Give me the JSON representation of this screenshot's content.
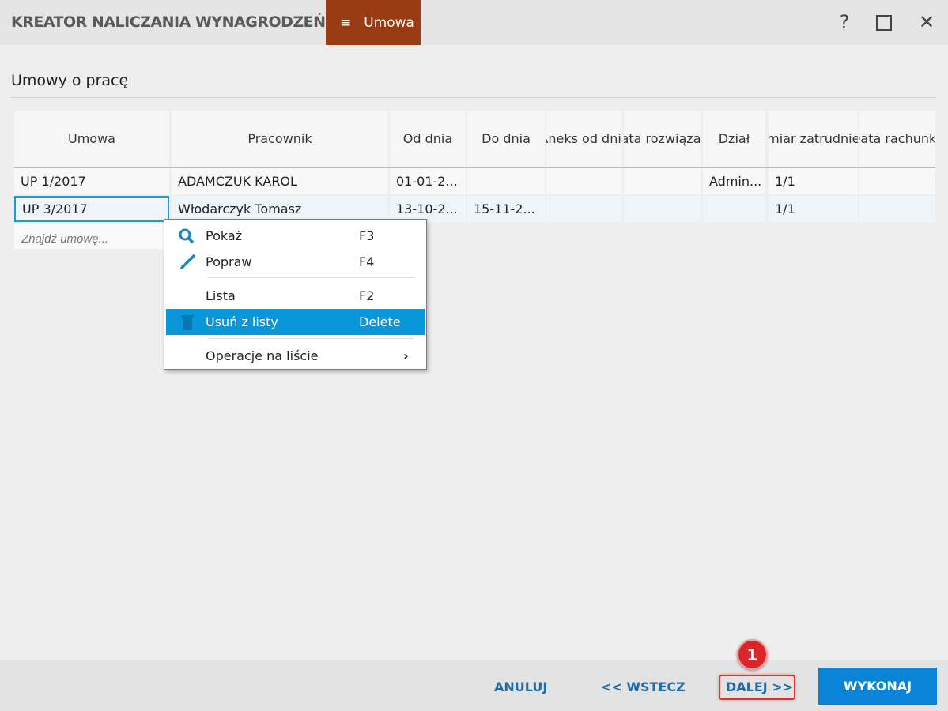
{
  "window": {
    "title": "KREATOR NALICZANIA WYNAGRODZEŃ",
    "tab_label": "Umowa",
    "help": "?"
  },
  "section_title": "Umowy o pracę",
  "table": {
    "headers": [
      "Umowa",
      "Pracownik",
      "Od dnia",
      "Do dnia",
      "Aneks od dnia",
      "Data rozwiąza...",
      "Dział",
      "Wymiar zatrudnienia",
      "Data rachunku"
    ],
    "rows": [
      [
        "UP 1/2017",
        "ADAMCZUK KAROL",
        "01-01-2...",
        "",
        "",
        "",
        "Admin...",
        "1/1",
        ""
      ],
      [
        "UP 3/2017",
        "Włodarczyk Tomasz",
        "13-10-2...",
        "15-11-2...",
        "",
        "",
        "",
        "1/1",
        ""
      ]
    ],
    "search_placeholder": "Znajdź umowę..."
  },
  "context_menu": {
    "items": [
      {
        "label": "Pokaż",
        "key": "F3",
        "icon": "search-icon"
      },
      {
        "label": "Popraw",
        "key": "F4",
        "icon": "brush-icon"
      },
      {
        "label": "Lista",
        "key": "F2"
      },
      {
        "label": "Usuń z listy",
        "key": "Delete",
        "icon": "trash-icon"
      },
      {
        "label": "Operacje na liście",
        "key": "›"
      }
    ]
  },
  "footer": {
    "cancel": "ANULUJ",
    "back": "<< WSTECZ",
    "next": "DALEJ >>",
    "execute": "WYKONAJ",
    "badge": "1"
  },
  "colors": {
    "accent": "#0897d8",
    "tab": "#993b13",
    "badge": "#d9262b"
  }
}
